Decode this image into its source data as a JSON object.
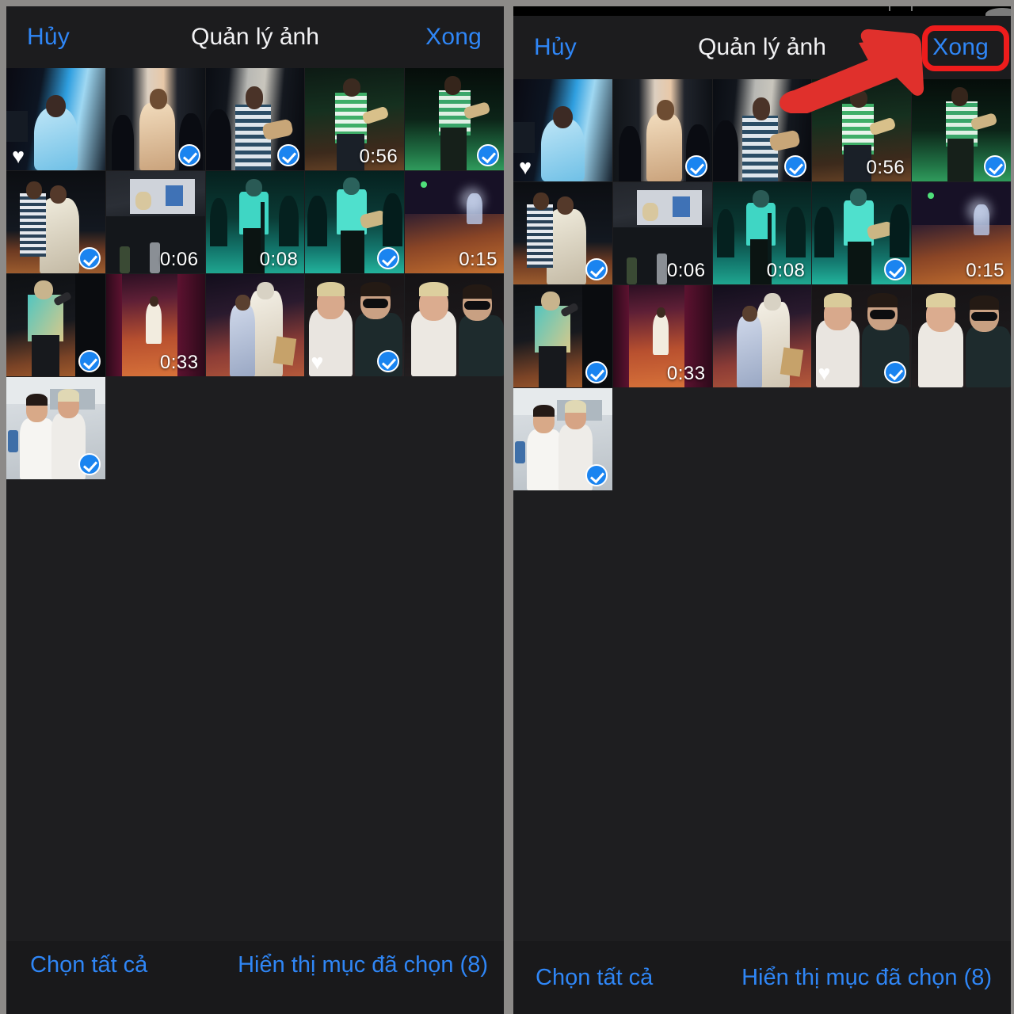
{
  "app": {
    "nav": {
      "cancel_label": "Hủy",
      "title": "Quản lý ảnh",
      "done_label": "Xong"
    },
    "bottom": {
      "select_all_label": "Chọn tất cả",
      "show_selected_label": "Hiển thị mục đã chọn (8)"
    },
    "selected_count": 8
  },
  "colors": {
    "accent_blue": "#2f86f6",
    "check_blue": "#1a84f0",
    "annotation_red": "#ee1c1c",
    "panel_bg": "#1e1e20",
    "navbar_bg": "#1c1c1e",
    "page_bg": "#8c8a88"
  },
  "annotation": {
    "arrow_icon": "arrow-up-right-icon",
    "highlight_target": "Xong",
    "color": "#ee1c1c"
  },
  "grid": {
    "columns": 5,
    "items": [
      {
        "id": 1,
        "kind": "photo",
        "badge": "heart-icon",
        "selected": false,
        "duration": null,
        "alt": "singer in blue dress on stage"
      },
      {
        "id": 2,
        "kind": "photo",
        "badge": "check-icon",
        "selected": true,
        "duration": null,
        "alt": "woman singing into microphone"
      },
      {
        "id": 3,
        "kind": "photo",
        "badge": "check-icon",
        "selected": true,
        "duration": null,
        "alt": "man with guitar at microphone"
      },
      {
        "id": 4,
        "kind": "video",
        "badge": null,
        "selected": false,
        "duration": "0:56",
        "alt": "guitarist in green striped shirt"
      },
      {
        "id": 5,
        "kind": "photo",
        "badge": "check-icon",
        "selected": true,
        "duration": null,
        "alt": "guitarist under green stage light"
      },
      {
        "id": 6,
        "kind": "photo",
        "badge": "check-icon",
        "selected": true,
        "duration": null,
        "alt": "couple dancing on stage"
      },
      {
        "id": 7,
        "kind": "video",
        "badge": null,
        "selected": false,
        "duration": "0:06",
        "alt": "dim backstage room"
      },
      {
        "id": 8,
        "kind": "video",
        "badge": null,
        "selected": false,
        "duration": "0:08",
        "alt": "performer in teal light with crowd"
      },
      {
        "id": 9,
        "kind": "photo",
        "badge": "check-icon",
        "selected": true,
        "duration": null,
        "alt": "guitarist in teal light"
      },
      {
        "id": 10,
        "kind": "video",
        "badge": null,
        "selected": false,
        "duration": "0:15",
        "alt": "performer on wooden stage floor"
      },
      {
        "id": 11,
        "kind": "photo",
        "badge": "check-icon",
        "selected": true,
        "duration": null,
        "alt": "singer with microphone on stage"
      },
      {
        "id": 12,
        "kind": "video",
        "badge": null,
        "selected": false,
        "duration": "0:33",
        "alt": "woman in white dress on red stage"
      },
      {
        "id": 13,
        "kind": "photo",
        "badge": null,
        "selected": false,
        "duration": null,
        "alt": "two people with bouquet on stage"
      },
      {
        "id": 14,
        "kind": "photo",
        "badge": "heart-check",
        "selected": true,
        "duration": null,
        "alt": "selfie of two friends posing"
      },
      {
        "id": 15,
        "kind": "photo",
        "badge": null,
        "selected": false,
        "duration": null,
        "alt": "selfie of two friends making signs"
      },
      {
        "id": 16,
        "kind": "photo",
        "badge": "check-icon",
        "selected": true,
        "duration": null,
        "alt": "two women in white posing indoors"
      }
    ]
  }
}
